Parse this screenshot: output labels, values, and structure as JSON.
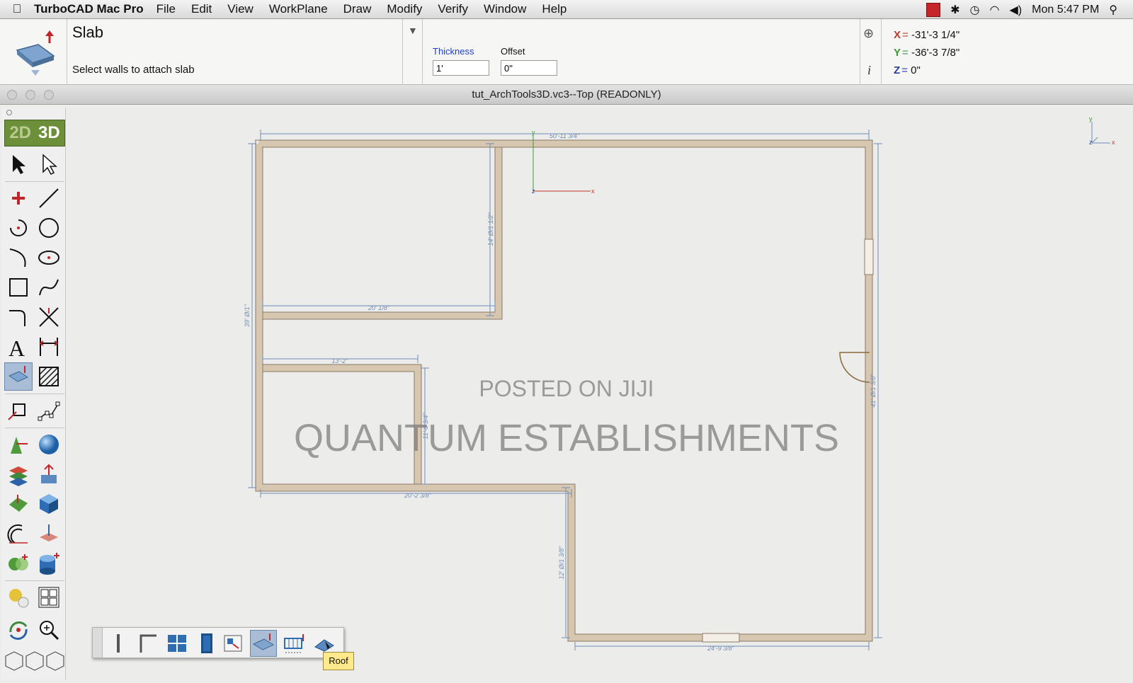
{
  "menubar": {
    "app_name": "TurboCAD Mac Pro",
    "items": [
      "File",
      "Edit",
      "View",
      "WorkPlane",
      "Draw",
      "Modify",
      "Verify",
      "Window",
      "Help"
    ],
    "clock": "Mon 5:47 PM"
  },
  "property_bar": {
    "tool_name": "Slab",
    "prompt": "Select walls to attach slab",
    "thickness_label": "Thickness",
    "thickness_value": "1'",
    "offset_label": "Offset",
    "offset_value": "0\"",
    "coords": {
      "x_label": "X",
      "x_value": "-31'-3 1/4\"",
      "y_label": "Y",
      "y_value": "-36'-3 7/8\"",
      "z_label": "Z",
      "z_value": "0\""
    }
  },
  "document": {
    "title": "tut_ArchTools3D.vc3--Top (READONLY)"
  },
  "palette": {
    "tab_2d": "2D",
    "tab_3d": "3D"
  },
  "subbar": {
    "tooltip": "Roof"
  },
  "watermark": {
    "line1": "POSTED ON JIJI",
    "line2": "QUANTUM ESTABLISHMENTS"
  },
  "dimensions": {
    "top": "50'-11 3/4\"",
    "inner_vertical": "14' Ø/1 1/2\"",
    "room1_bottom": "20' 1/8\"",
    "room2_top": "13'-2\"",
    "room2_right": "11'-8 3/4\"",
    "left": "39' Ø/1\"",
    "bottom_left": "20'-2 3/8\"",
    "lower_vertical": "12' Ø/1 3/8\"",
    "bottom_right": "24'-9 3/8\"",
    "right": "41' Ø/1 3/8\""
  },
  "colors": {
    "palette_accent": "#6d8f3a",
    "active_tool": "#a9bdd6",
    "wall": "#e4d3bc",
    "dimension": "#6f8db8",
    "coord_x": "#c0392b",
    "coord_y": "#3a9a3a",
    "coord_z": "#2c3e9e"
  },
  "icons": {
    "palette": [
      "select-arrow",
      "select-hollow-arrow",
      "point-plus",
      "line",
      "arc-center",
      "circle",
      "arc",
      "ellipse",
      "rectangle",
      "spline",
      "fillet",
      "trim-cross",
      "text-A",
      "dimension",
      "slab",
      "hatch",
      "snap-box",
      "nodes",
      "vertex-tool",
      "sphere",
      "layers-stack",
      "extrude-arrows",
      "plane-tool",
      "cube",
      "revolve",
      "push-pull",
      "boolean",
      "cylinder",
      "render",
      "views-grid",
      "orbit",
      "zoom-magnifier"
    ],
    "subbar": [
      "wall",
      "corner-wall",
      "window",
      "door",
      "room",
      "slab",
      "stair",
      "roof"
    ]
  }
}
